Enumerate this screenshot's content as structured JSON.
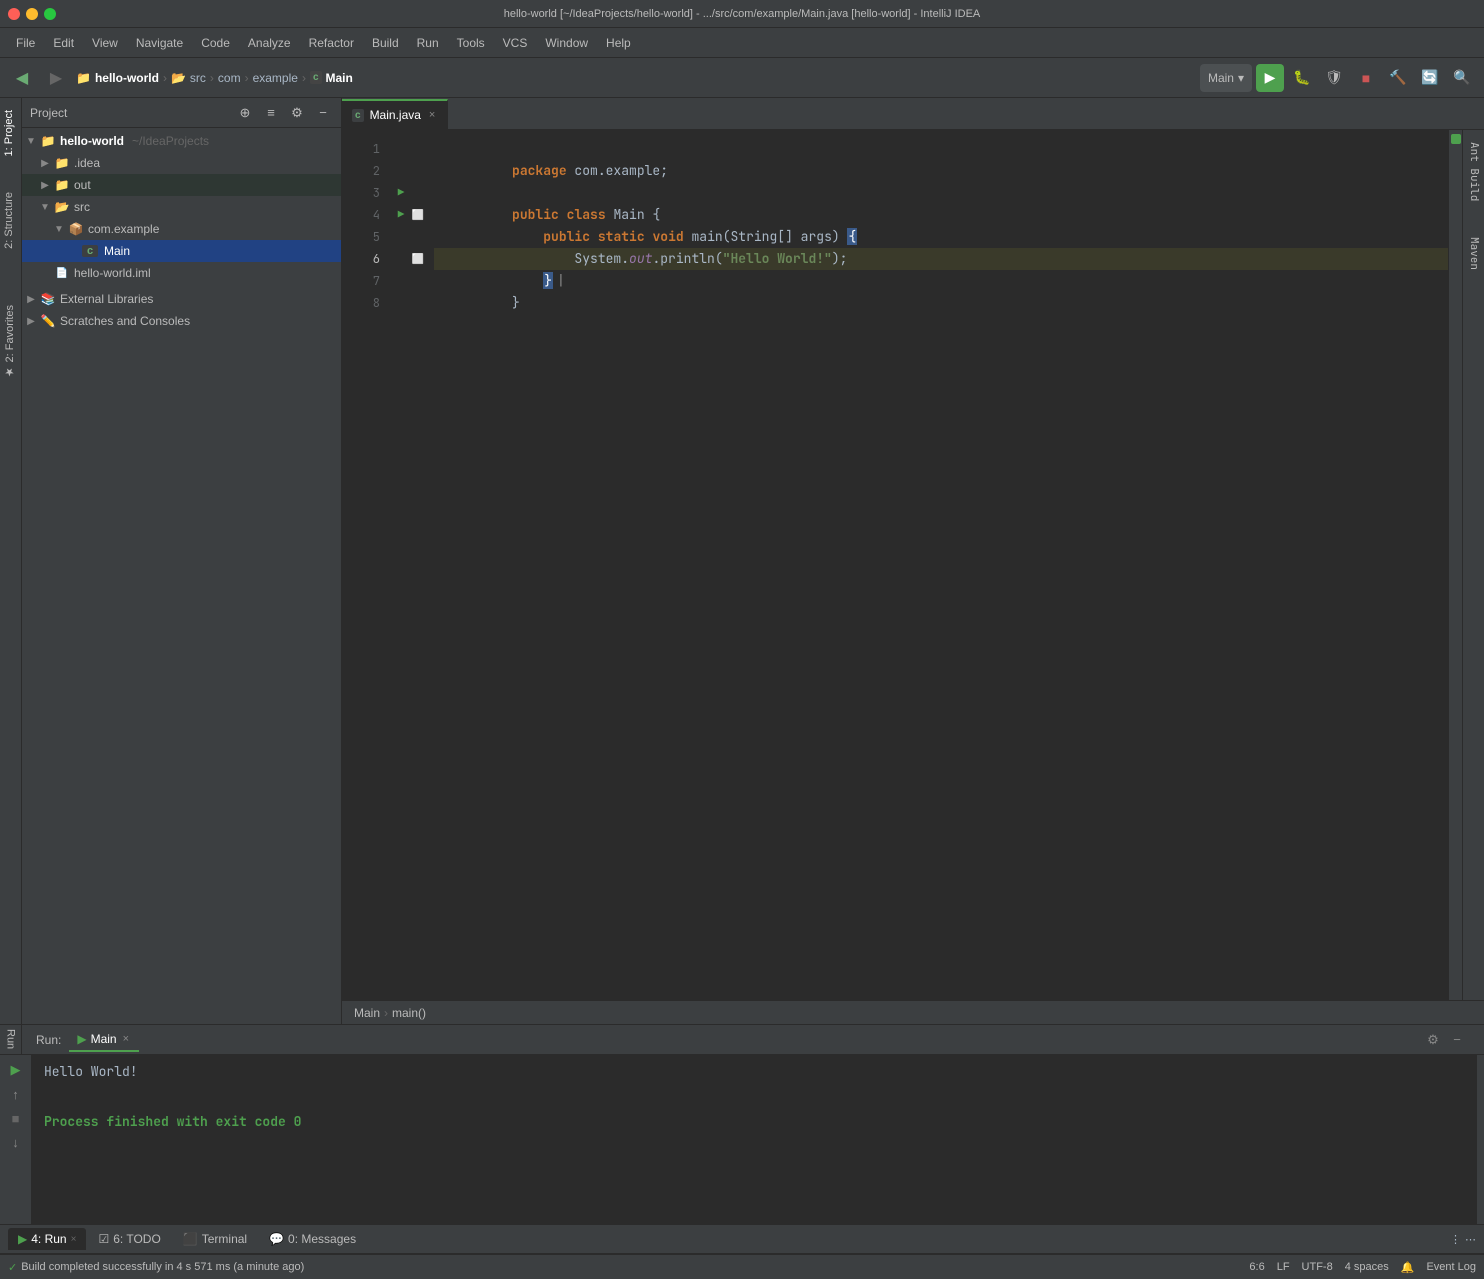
{
  "window": {
    "title": "hello-world [~/IdeaProjects/hello-world] - .../src/com/example/Main.java [hello-world] - IntelliJ IDEA"
  },
  "menu": {
    "items": [
      "File",
      "Edit",
      "View",
      "Navigate",
      "Code",
      "Analyze",
      "Refactor",
      "Build",
      "Run",
      "Tools",
      "VCS",
      "Window",
      "Help"
    ]
  },
  "breadcrumb": {
    "project": "hello-world",
    "path1": "src",
    "path2": "com",
    "path3": "example",
    "path4": "Main"
  },
  "run_config": {
    "name": "Main"
  },
  "project_panel": {
    "title": "Project",
    "root": "hello-world",
    "root_path": "~/IdeaProjects",
    "items": [
      {
        "label": ".idea",
        "type": "folder",
        "depth": 1,
        "collapsed": true
      },
      {
        "label": "out",
        "type": "folder-out",
        "depth": 1,
        "collapsed": true
      },
      {
        "label": "src",
        "type": "folder-src",
        "depth": 1,
        "collapsed": false
      },
      {
        "label": "com.example",
        "type": "package",
        "depth": 2,
        "collapsed": false
      },
      {
        "label": "Main",
        "type": "java",
        "depth": 3,
        "collapsed": false,
        "selected": true
      },
      {
        "label": "hello-world.iml",
        "type": "iml",
        "depth": 1
      }
    ],
    "external_libraries": "External Libraries",
    "scratches": "Scratches and Consoles"
  },
  "editor": {
    "tab_name": "Main.java",
    "lines": [
      {
        "num": 1,
        "code": "package com.example;",
        "type": "normal"
      },
      {
        "num": 2,
        "code": "",
        "type": "normal"
      },
      {
        "num": 3,
        "code": "public class Main {",
        "type": "run"
      },
      {
        "num": 4,
        "code": "    public static void main(String[] args) {",
        "type": "run-fold"
      },
      {
        "num": 5,
        "code": "        System.out.println(\"Hello World!\");",
        "type": "normal"
      },
      {
        "num": 6,
        "code": "    }",
        "type": "highlighted"
      },
      {
        "num": 7,
        "code": "}",
        "type": "normal"
      },
      {
        "num": 8,
        "code": "",
        "type": "normal"
      }
    ],
    "breadcrumb_bottom": "Main  ›  main()"
  },
  "run_panel": {
    "tab": "Main",
    "output_hello": "Hello World!",
    "output_process": "Process finished with exit code 0"
  },
  "bottom_tabs": [
    {
      "label": "4: Run",
      "active": true,
      "icon": "run"
    },
    {
      "label": "6: TODO",
      "active": false,
      "icon": "todo"
    },
    {
      "label": "Terminal",
      "active": false,
      "icon": "terminal"
    },
    {
      "label": "0: Messages",
      "active": false,
      "icon": "messages"
    }
  ],
  "status_bar": {
    "message": "Build completed successfully in 4 s 571 ms (a minute ago)",
    "position": "6:6",
    "line_sep": "LF",
    "encoding": "UTF-8",
    "indent": "4 spaces",
    "event_log": "Event Log"
  },
  "right_panel_tabs": [
    "Ant Build",
    "Maven"
  ],
  "left_panel_tabs": [
    "1: Project",
    "2: Structure",
    "Favorites"
  ]
}
